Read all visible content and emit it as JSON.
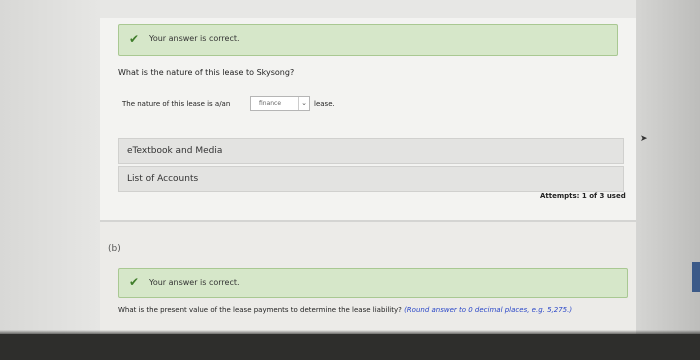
{
  "part_a": {
    "feedback": "Your answer is correct.",
    "question": "What is the nature of this lease to Skysong?",
    "answer_prefix": "The nature of this lease is a/an",
    "answer_value": "finance",
    "answer_suffix": "lease.",
    "resources": [
      "eTextbook and Media",
      "List of Accounts"
    ],
    "attempts": "Attempts: 1 of 3 used"
  },
  "part_b": {
    "label": "(b)",
    "feedback": "Your answer is correct.",
    "question": "What is the present value of the lease payments to determine the lease liability?",
    "hint": "(Round answer to 0 decimal places, e.g. 5,275.)"
  },
  "icons": {
    "check": "check-icon",
    "chevron": "chevron-down-icon"
  },
  "colors": {
    "success_bg": "#d6e7c9",
    "success_border": "#a9c892",
    "hint": "#2a47c8"
  }
}
